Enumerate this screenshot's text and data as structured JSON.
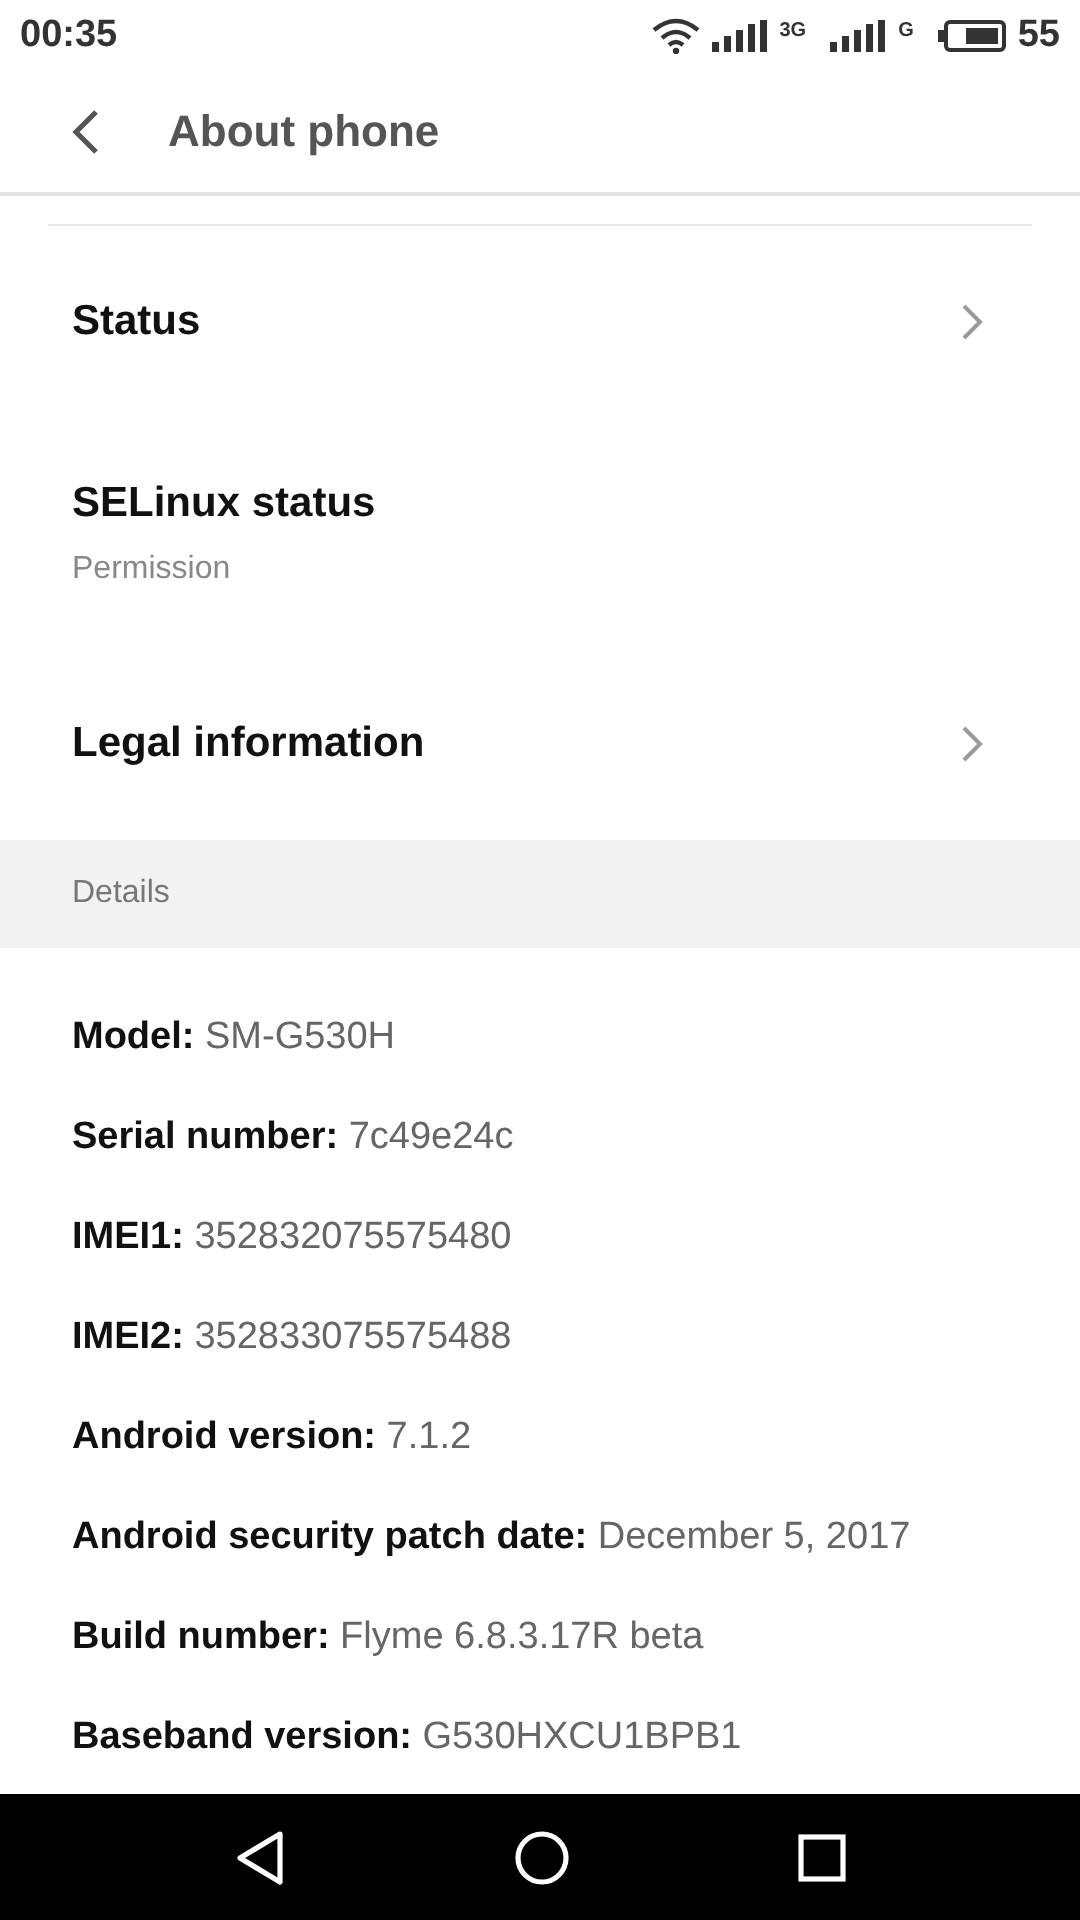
{
  "status_bar": {
    "time": "00:35",
    "network_1": "3G",
    "network_2": "G",
    "battery": "55"
  },
  "toolbar": {
    "title": "About phone"
  },
  "items": [
    {
      "kind": "link",
      "title": "Status"
    },
    {
      "kind": "info",
      "title": "SELinux status",
      "subtitle": "Permission"
    },
    {
      "kind": "link",
      "title": "Legal information"
    }
  ],
  "section": {
    "title": "Details"
  },
  "details": [
    "**Model:** SM-G530H",
    "**Serial number:** 7c49e24c",
    "**IMEI1:** 352832075575480",
    "**IMEI2:** 352833075575488",
    "**Android version:** 7.1.2",
    "**Android security patch date:** December 5, 2017",
    "**Build number:** Flyme 6.8.3.17R beta",
    "**Baseband version:** G530HXCU1BPB1"
  ]
}
